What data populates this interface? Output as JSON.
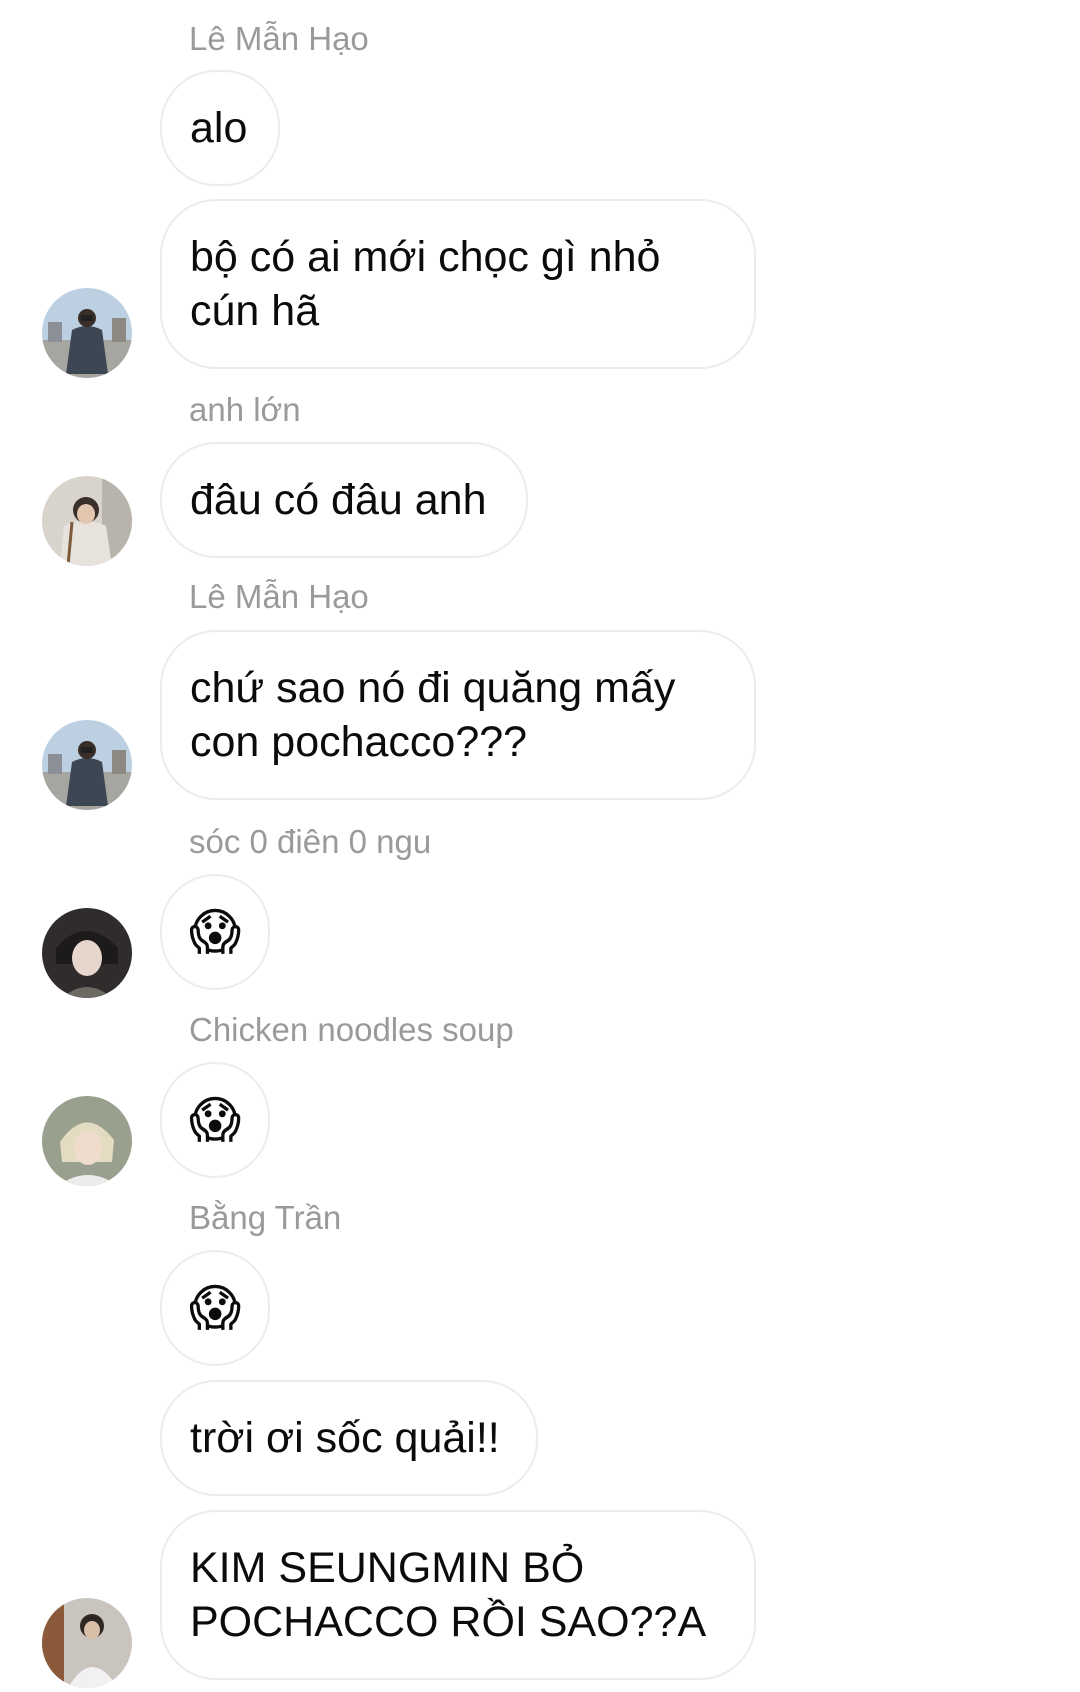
{
  "chat": {
    "senders": {
      "s1": "Lê Mẫn Hạo",
      "s2": "anh lớn",
      "s3": "Lê Mẫn Hạo",
      "s4": "sóc 0 điên 0 ngu",
      "s5": "Chicken noodles soup",
      "s6": "Bằng Trần"
    },
    "messages": {
      "m1": "alo",
      "m2": "bộ có ai mới chọc gì nhỏ\ncún hã",
      "m3": "đâu có đâu anh",
      "m4": "chứ sao nó đi quăng mấy\ncon pochacco???",
      "m5": "😱",
      "m6": "😱",
      "m7": "😱",
      "m8": "trời ơi sốc quải!!",
      "m9": "KIM SEUNGMIN BỎ\nPOCHACCO RỒI SAO??A"
    }
  },
  "colors": {
    "background": "#ffffff",
    "bubble_border": "#ececec",
    "sender_text": "#9a9a9a",
    "message_text": "#0b0b0b"
  }
}
